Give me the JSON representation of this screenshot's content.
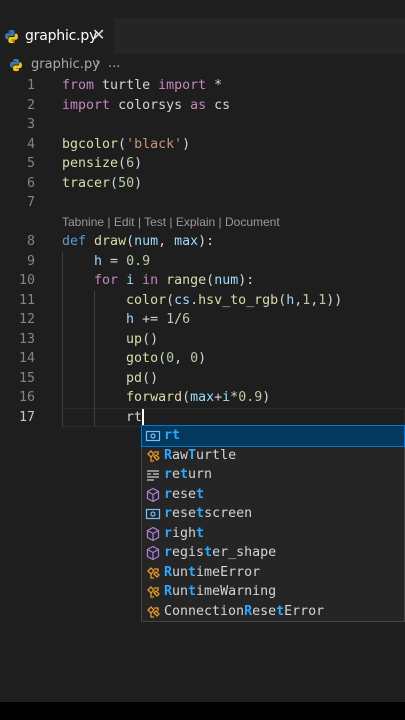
{
  "tab": {
    "label": "graphic.py",
    "close_glyph": "✕"
  },
  "breadcrumb": {
    "file": "graphic.py",
    "separator": "›",
    "more": "..."
  },
  "codelens": "Tabnine | Edit | Test | Explain | Document",
  "lines": [
    {
      "num": "1",
      "parts": [
        [
          "kw",
          "from"
        ],
        [
          "sp",
          " "
        ],
        [
          "txt",
          "turtle"
        ],
        [
          "sp",
          " "
        ],
        [
          "kw",
          "import"
        ],
        [
          "sp",
          " "
        ],
        [
          "txt",
          "*"
        ]
      ]
    },
    {
      "num": "2",
      "parts": [
        [
          "kw",
          "import"
        ],
        [
          "sp",
          " "
        ],
        [
          "txt",
          "colorsys"
        ],
        [
          "sp",
          " "
        ],
        [
          "kw",
          "as"
        ],
        [
          "sp",
          " "
        ],
        [
          "txt",
          "cs"
        ]
      ]
    },
    {
      "num": "3",
      "parts": []
    },
    {
      "num": "4",
      "parts": [
        [
          "fn",
          "bgcolor"
        ],
        [
          "txt",
          "("
        ],
        [
          "str",
          "'black'"
        ],
        [
          "txt",
          ")"
        ]
      ]
    },
    {
      "num": "5",
      "parts": [
        [
          "fn",
          "pensize"
        ],
        [
          "txt",
          "("
        ],
        [
          "num",
          "6"
        ],
        [
          "txt",
          ")"
        ]
      ]
    },
    {
      "num": "6",
      "parts": [
        [
          "fn",
          "tracer"
        ],
        [
          "txt",
          "("
        ],
        [
          "num",
          "50"
        ],
        [
          "txt",
          ")"
        ]
      ]
    },
    {
      "num": "7",
      "parts": []
    },
    {
      "num": "8",
      "parts": [
        [
          "kw2",
          "def"
        ],
        [
          "sp",
          " "
        ],
        [
          "fn",
          "draw"
        ],
        [
          "txt",
          "("
        ],
        [
          "var",
          "num"
        ],
        [
          "txt",
          ", "
        ],
        [
          "var",
          "max"
        ],
        [
          "txt",
          "):"
        ]
      ]
    },
    {
      "num": "9",
      "parts": [
        [
          "sp",
          "    "
        ],
        [
          "var",
          "h"
        ],
        [
          "txt",
          " = "
        ],
        [
          "num",
          "0.9"
        ]
      ]
    },
    {
      "num": "10",
      "parts": [
        [
          "sp",
          "    "
        ],
        [
          "kw",
          "for"
        ],
        [
          "sp",
          " "
        ],
        [
          "var",
          "i"
        ],
        [
          "sp",
          " "
        ],
        [
          "kw",
          "in"
        ],
        [
          "sp",
          " "
        ],
        [
          "fn",
          "range"
        ],
        [
          "txt",
          "("
        ],
        [
          "var",
          "num"
        ],
        [
          "txt",
          "):"
        ]
      ]
    },
    {
      "num": "11",
      "parts": [
        [
          "sp",
          "        "
        ],
        [
          "fn",
          "color"
        ],
        [
          "txt",
          "("
        ],
        [
          "var",
          "cs"
        ],
        [
          "txt",
          "."
        ],
        [
          "fn",
          "hsv_to_rgb"
        ],
        [
          "txt",
          "("
        ],
        [
          "var",
          "h"
        ],
        [
          "txt",
          ","
        ],
        [
          "num",
          "1"
        ],
        [
          "txt",
          ","
        ],
        [
          "num",
          "1"
        ],
        [
          "txt",
          "))"
        ]
      ]
    },
    {
      "num": "12",
      "parts": [
        [
          "sp",
          "        "
        ],
        [
          "var",
          "h"
        ],
        [
          "txt",
          " += "
        ],
        [
          "num",
          "1"
        ],
        [
          "txt",
          "/"
        ],
        [
          "num",
          "6"
        ]
      ]
    },
    {
      "num": "13",
      "parts": [
        [
          "sp",
          "        "
        ],
        [
          "fn",
          "up"
        ],
        [
          "txt",
          "()"
        ]
      ]
    },
    {
      "num": "14",
      "parts": [
        [
          "sp",
          "        "
        ],
        [
          "fn",
          "goto"
        ],
        [
          "txt",
          "("
        ],
        [
          "num",
          "0"
        ],
        [
          "txt",
          ", "
        ],
        [
          "num",
          "0"
        ],
        [
          "txt",
          ")"
        ]
      ]
    },
    {
      "num": "15",
      "parts": [
        [
          "sp",
          "        "
        ],
        [
          "fn",
          "pd"
        ],
        [
          "txt",
          "()"
        ]
      ]
    },
    {
      "num": "16",
      "parts": [
        [
          "sp",
          "        "
        ],
        [
          "fn",
          "forward"
        ],
        [
          "txt",
          "("
        ],
        [
          "var",
          "max"
        ],
        [
          "txt",
          "+"
        ],
        [
          "var",
          "i"
        ],
        [
          "txt",
          "*"
        ],
        [
          "num",
          "0.9"
        ],
        [
          "txt",
          ")"
        ]
      ]
    },
    {
      "num": "17",
      "parts": [
        [
          "sp",
          "        "
        ],
        [
          "txt",
          "rt"
        ]
      ]
    }
  ],
  "suggestions": [
    {
      "icon": "field",
      "pre": "",
      "hl": "rt",
      "post": "",
      "selected": true
    },
    {
      "icon": "class",
      "pre": "",
      "hl": "R",
      "mid": "aw",
      "hl2": "T",
      "post": "urtle"
    },
    {
      "icon": "keyword",
      "pre": "",
      "hl": "r",
      "mid": "e",
      "hl2": "t",
      "post": "urn"
    },
    {
      "icon": "method",
      "pre": "",
      "hl": "r",
      "mid": "ese",
      "hl2": "t",
      "post": ""
    },
    {
      "icon": "field",
      "pre": "",
      "hl": "r",
      "mid": "ese",
      "hl2": "t",
      "post": "screen"
    },
    {
      "icon": "method",
      "pre": "",
      "hl": "r",
      "mid": "igh",
      "hl2": "t",
      "post": ""
    },
    {
      "icon": "method",
      "pre": "",
      "hl": "r",
      "mid": "egis",
      "hl2": "t",
      "post": "er_shape"
    },
    {
      "icon": "class",
      "pre": "",
      "hl": "R",
      "mid": "un",
      "hl2": "t",
      "post": "imeError"
    },
    {
      "icon": "class",
      "pre": "",
      "hl": "R",
      "mid": "un",
      "hl2": "t",
      "post": "imeWarning"
    },
    {
      "icon": "class",
      "pre": "Connection",
      "hl": "R",
      "mid": "ese",
      "hl2": "t",
      "post": "Error"
    }
  ],
  "colors": {
    "kw": "#c586c0",
    "kw2": "#569cd6",
    "fn": "#dcdcaa",
    "str": "#ce9178",
    "num": "#b5cea8",
    "var": "#9cdcfe",
    "txt": "#d4d4d4",
    "sp": "#d4d4d4",
    "icon_class": "#ee9d28",
    "icon_method": "#b180d7",
    "icon_field": "#75beff",
    "icon_keyword": "#cccccc"
  }
}
